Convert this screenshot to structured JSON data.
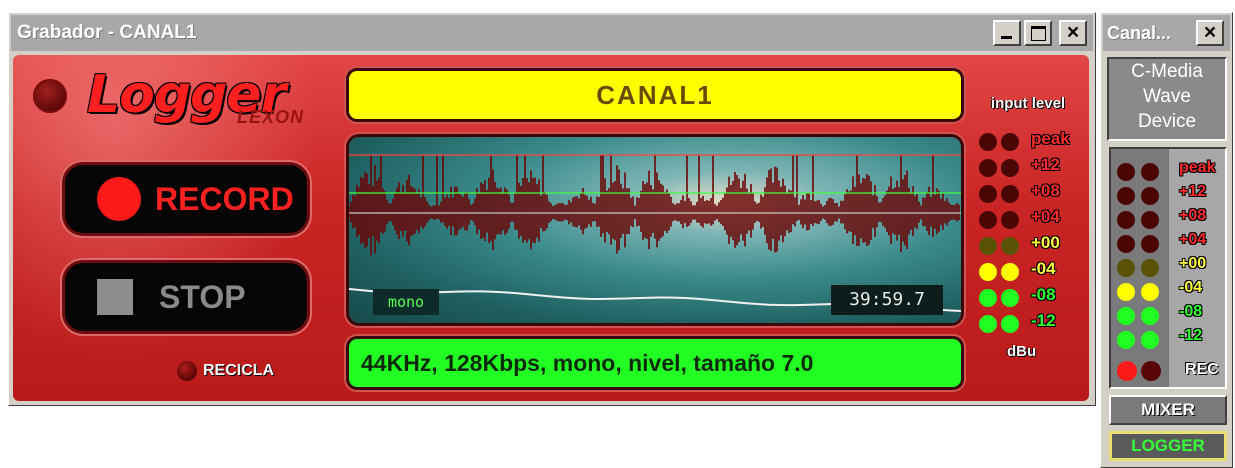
{
  "main_window": {
    "title": "Grabador - CANAL1",
    "logo": "Logger",
    "logo_sub": "LEXON",
    "record_label": "RECORD",
    "stop_label": "STOP",
    "recicla_label": "RECICLA",
    "channel_name": "CANAL1",
    "mono_label": "mono",
    "time": "39:59.7",
    "info": "44KHz, 128Kbps, mono, nivel, tamaño 7.0",
    "meter_title": "input level",
    "meter_unit": "dBu",
    "meter_labels": [
      {
        "text": "peak",
        "color": "#ff2a2a"
      },
      {
        "text": "+12",
        "color": "#ff2a2a"
      },
      {
        "text": "+08",
        "color": "#ff2a2a"
      },
      {
        "text": "+04",
        "color": "#ff2a2a"
      },
      {
        "text": "+00",
        "color": "#ffff40"
      },
      {
        "text": "-04",
        "color": "#ffff40"
      },
      {
        "text": "-08",
        "color": "#30ff30"
      },
      {
        "text": "-12",
        "color": "#30ff30"
      }
    ],
    "meter_leds": [
      "#4a0505",
      "#4a0505",
      "#4a0505",
      "#4a0505",
      "#5a5205",
      "#ffff00",
      "#22ff22",
      "#22ff22"
    ]
  },
  "side_window": {
    "title": "Canal...",
    "device": [
      "C-Media",
      "Wave",
      "Device"
    ],
    "meter_labels": [
      {
        "text": "peak",
        "color": "#ff2a2a"
      },
      {
        "text": "+12",
        "color": "#ff2a2a"
      },
      {
        "text": "+08",
        "color": "#ff2a2a"
      },
      {
        "text": "+04",
        "color": "#ff2a2a"
      },
      {
        "text": "+00",
        "color": "#ffff40"
      },
      {
        "text": "-04",
        "color": "#ffff40"
      },
      {
        "text": "-08",
        "color": "#30ff30"
      },
      {
        "text": "-12",
        "color": "#30ff30"
      }
    ],
    "meter_leds": [
      "#4a0505",
      "#4a0505",
      "#4a0505",
      "#4a0505",
      "#5a5205",
      "#ffff00",
      "#22ff22",
      "#22ff22"
    ],
    "rec_led_colors": [
      "#ff1a1a",
      "#5a0505"
    ],
    "rec_label": "REC",
    "mixer_label": "MIXER",
    "logger_label": "LOGGER"
  }
}
